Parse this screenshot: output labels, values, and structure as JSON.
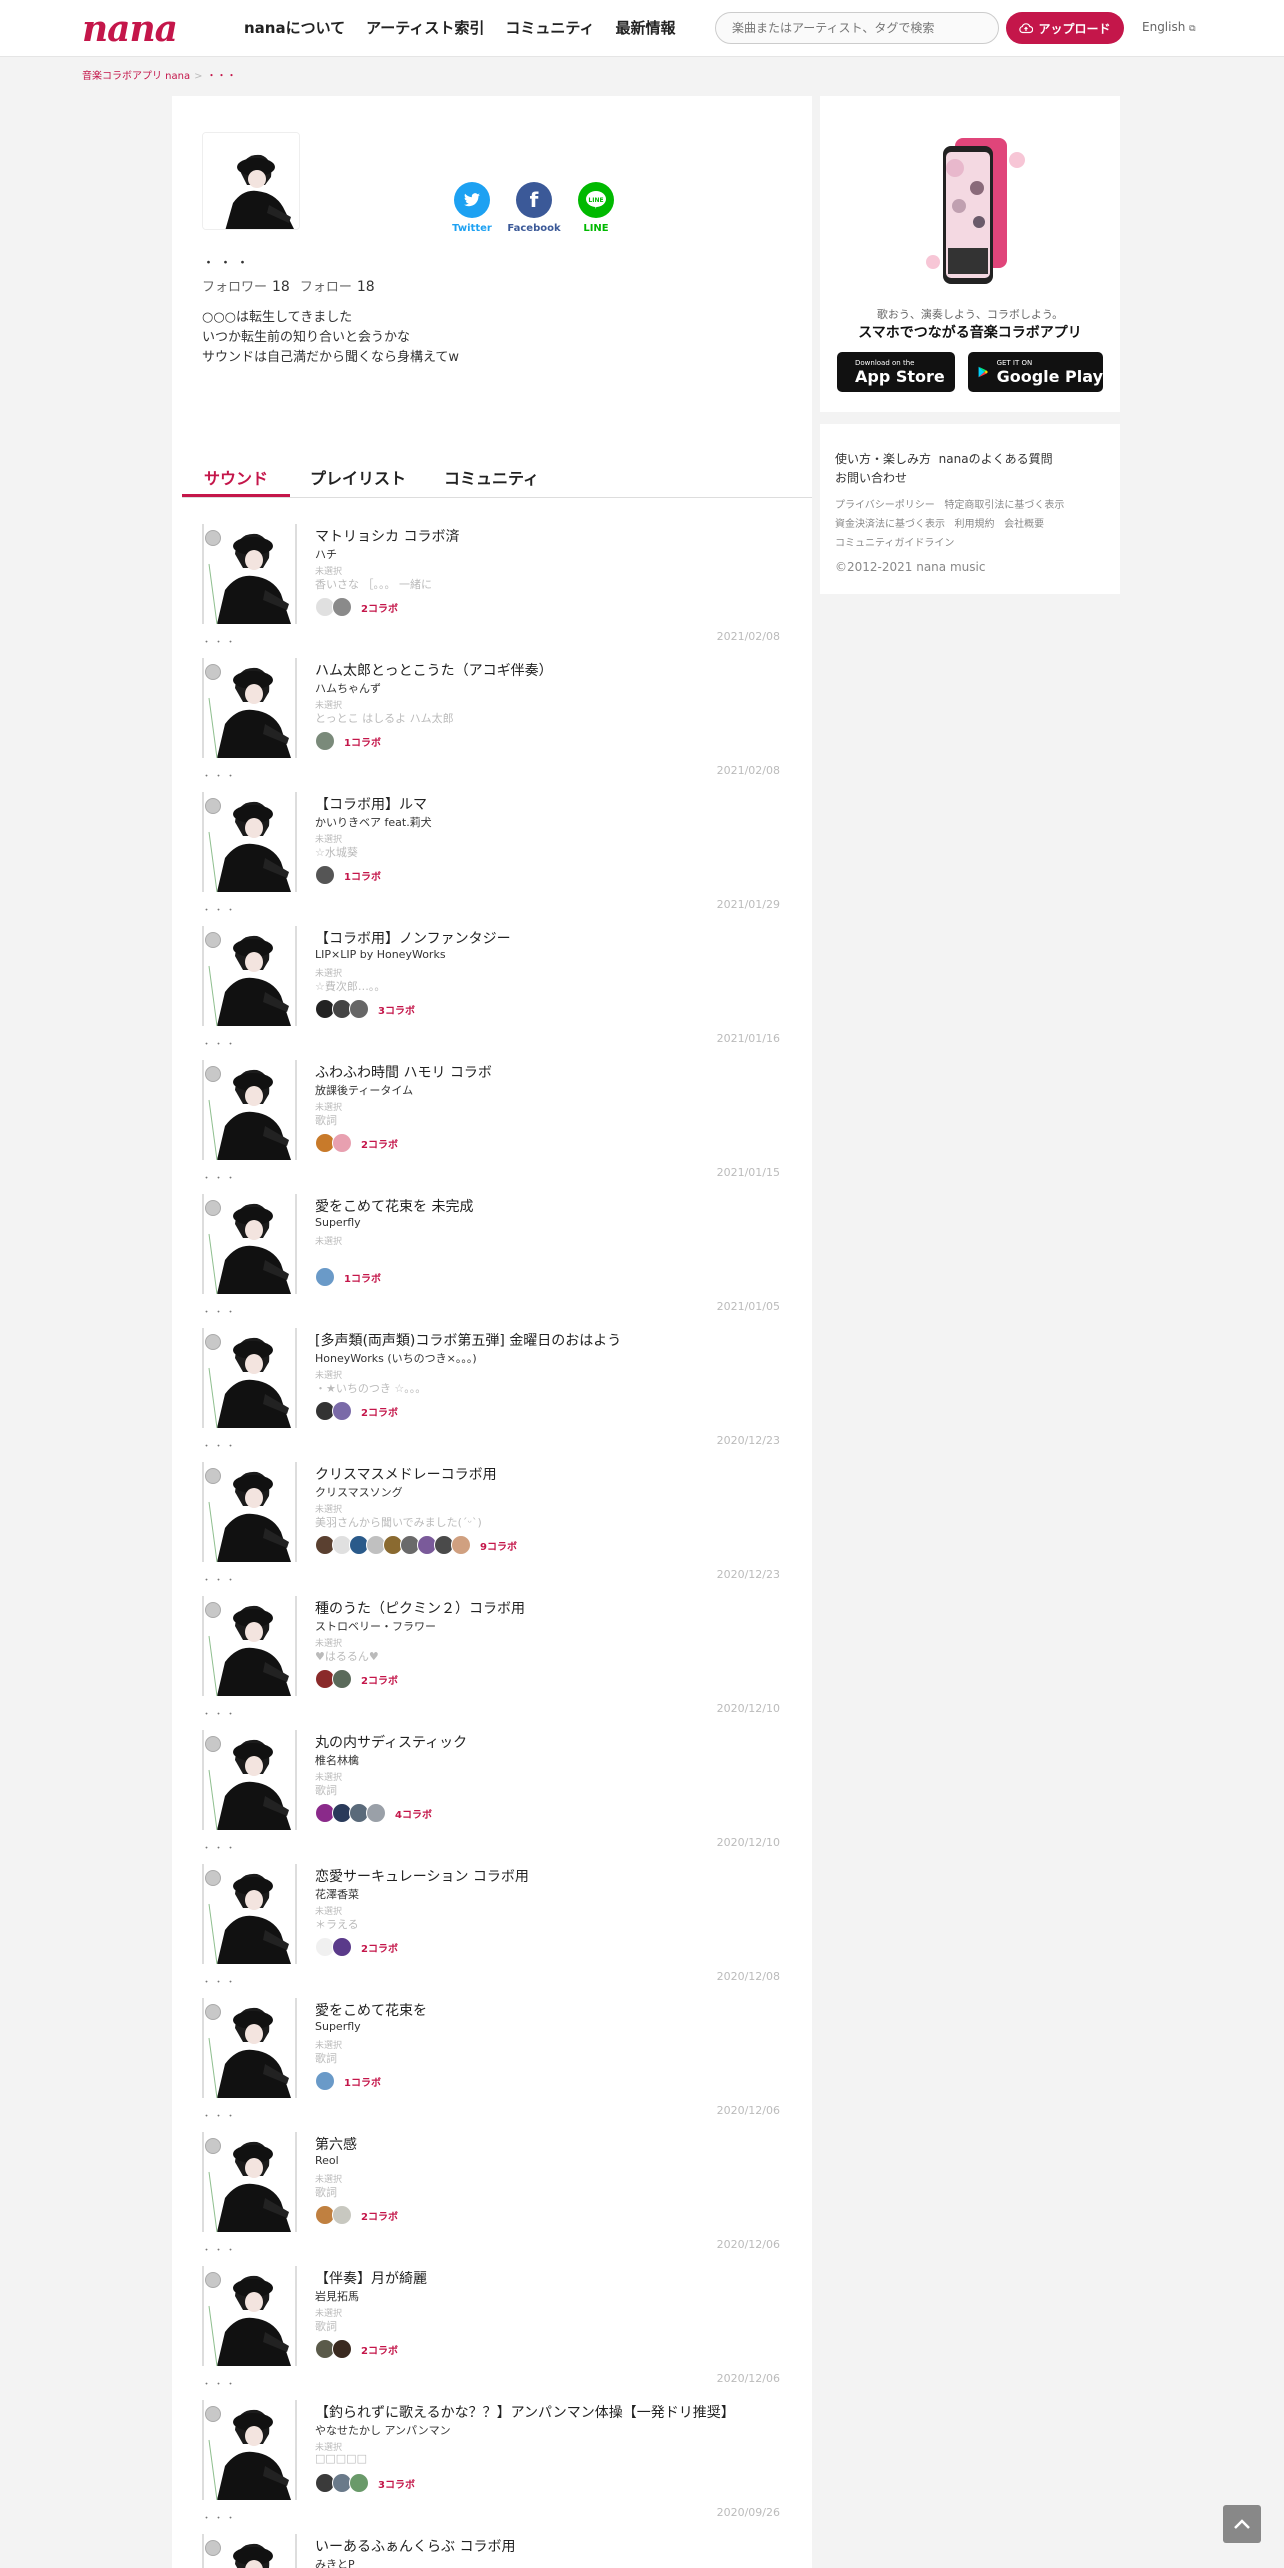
{
  "header": {
    "logo": "nana",
    "nav": [
      "nanaについて",
      "アーティスト索引",
      "コミュニティ",
      "最新情報"
    ],
    "search_placeholder": "楽曲またはアーティスト、タグで検索",
    "upload_label": "アップロード",
    "language_label": "English"
  },
  "breadcrumb": {
    "home": "音楽コラボアプリ nana",
    "current": "・・・"
  },
  "profile": {
    "name": "・・・",
    "followers_label": "フォロワー",
    "followers": "18",
    "following_label": "フォロー",
    "following": "18",
    "bio": [
      "○○○は転生してきました",
      "いつか転生前の知り合いと会うかな",
      "サウンドは自己満だから聞くなら身構えてw"
    ],
    "share": [
      {
        "label": "Twitter",
        "color": "#1da1f2",
        "icon": "twitter-icon"
      },
      {
        "label": "Facebook",
        "color": "#3b5998",
        "icon": "facebook-icon"
      },
      {
        "label": "LINE",
        "color": "#00b900",
        "icon": "line-icon"
      }
    ]
  },
  "tabs": [
    "サウンド",
    "プレイリスト",
    "コミュニティ"
  ],
  "sounds": [
    {
      "title": "マトリョシカ コラボ済",
      "artist": "ハチ",
      "genre": "未選択",
      "desc": "香いさな ［。。。 一緒に",
      "collabs": "2コラボ",
      "date": "2021/02/08",
      "avatars": [
        "#e0e0e0",
        "#8a8a8a"
      ]
    },
    {
      "title": "ハム太郎とっとこうた（アコギ伴奏）",
      "artist": "ハムちゃんず",
      "genre": "未選択",
      "desc": "とっとこ はしるよ ハム太郎",
      "collabs": "1コラボ",
      "date": "2021/02/08",
      "avatars": [
        "#7a8a7a"
      ]
    },
    {
      "title": "【コラボ用】ルマ",
      "artist": "かいりきベア feat.莉犬",
      "genre": "未選択",
      "desc": "☆水城葵",
      "collabs": "1コラボ",
      "date": "2021/01/29",
      "avatars": [
        "#555555"
      ]
    },
    {
      "title": "【コラボ用】ノンファンタジー",
      "artist": "LIP×LIP by HoneyWorks",
      "genre": "未選択",
      "desc": "☆費次郎…。。",
      "collabs": "3コラボ",
      "date": "2021/01/16",
      "avatars": [
        "#222222",
        "#444444",
        "#666666"
      ]
    },
    {
      "title": "ふわふわ時間 ハモリ コラボ",
      "artist": "放課後ティータイム",
      "genre": "未選択",
      "desc": "歌詞",
      "collabs": "2コラボ",
      "date": "2021/01/15",
      "avatars": [
        "#c87a2a",
        "#e8a0b0"
      ]
    },
    {
      "title": "愛をこめて花束を 未完成",
      "artist": "Superfly",
      "genre": "未選択",
      "desc": "",
      "collabs": "1コラボ",
      "date": "2021/01/05",
      "avatars": [
        "#6a9ac8"
      ]
    },
    {
      "title": "[多声類(両声類)コラボ第五弾] 金曜日のおはよう",
      "artist": "HoneyWorks (いちのつき×。。。)",
      "genre": "未選択",
      "desc": "・★いちのつき ☆。。。",
      "collabs": "2コラボ",
      "date": "2020/12/23",
      "avatars": [
        "#333333",
        "#7a6aa8"
      ]
    },
    {
      "title": "クリスマスメドレーコラボ用",
      "artist": "クリスマスソング",
      "genre": "未選択",
      "desc": "美羽さんから聞いでみました(ˊᵕˋ)",
      "collabs": "9コラボ",
      "date": "2020/12/23",
      "avatars": [
        "#5a4030",
        "#e0e0e0",
        "#2a5a8a",
        "#c0c0c0",
        "#8a6a30",
        "#6a6a6a",
        "#7a5a9a",
        "#4a4a4a",
        "#d0a080"
      ]
    },
    {
      "title": "種のうた（ピクミン２）コラボ用",
      "artist": "ストロベリー・フラワー",
      "genre": "未選択",
      "desc": "♥はるるん♥",
      "collabs": "2コラボ",
      "date": "2020/12/10",
      "avatars": [
        "#8a2a2a",
        "#5a6a5a"
      ]
    },
    {
      "title": "丸の内サディスティック",
      "artist": "椎名林檎",
      "genre": "未選択",
      "desc": "歌詞",
      "collabs": "4コラボ",
      "date": "2020/12/10",
      "avatars": [
        "#8a2a8a",
        "#2a3a5a",
        "#5a6a7a",
        "#9aa0a8"
      ]
    },
    {
      "title": "恋愛サーキュレーション コラボ用",
      "artist": "花澤香菜",
      "genre": "未選択",
      "desc": "＊ラえる",
      "collabs": "2コラボ",
      "date": "2020/12/08",
      "avatars": [
        "#f0f0f0",
        "#5a3a8a"
      ]
    },
    {
      "title": "愛をこめて花束を",
      "artist": "Superfly",
      "genre": "未選択",
      "desc": "歌詞",
      "collabs": "1コラボ",
      "date": "2020/12/06",
      "avatars": [
        "#6a9ac8"
      ]
    },
    {
      "title": "第六感",
      "artist": "Reol",
      "genre": "未選択",
      "desc": "歌詞",
      "collabs": "2コラボ",
      "date": "2020/12/06",
      "avatars": [
        "#c08040",
        "#c8c8c0"
      ]
    },
    {
      "title": "【伴奏】月が綺麗",
      "artist": "岩見拓馬",
      "genre": "未選択",
      "desc": "歌詞",
      "collabs": "2コラボ",
      "date": "2020/12/06",
      "avatars": [
        "#5a5a4a",
        "#3a2a20"
      ]
    },
    {
      "title": "【釣られずに歌えるかな？？】アンパンマン体操【一発ドリ推奨】",
      "artist": "やなせたかし アンパンマン",
      "genre": "未選択",
      "desc": "□□□□□",
      "collabs": "3コラボ",
      "date": "2020/09/26",
      "avatars": [
        "#3a3a3a",
        "#6a7a8a",
        "#6a9a6a"
      ]
    },
    {
      "title": "いーあるふぁんくらぶ コラボ用",
      "artist": "みきとP",
      "genre": "",
      "desc": "",
      "collabs": "",
      "date": "",
      "avatars": []
    }
  ],
  "sidebar": {
    "tagline": "歌おう、演奏しよう、コラボしよう。",
    "headline": "スマホでつながる音楽コラボアプリ",
    "appstore_small": "Download on the",
    "appstore_big": "App Store",
    "googleplay_small": "GET IT ON",
    "googleplay_big": "Google Play",
    "links": [
      "使い方・楽しみ方",
      "nanaのよくある質問",
      "お問い合わせ"
    ],
    "small_links": [
      "プライバシーポリシー",
      "特定商取引法に基づく表示",
      "資金決済法に基づく表示",
      "利用規約",
      "会社概要",
      "コミュニティガイドライン"
    ],
    "copyright": "©2012-2021 nana music"
  }
}
